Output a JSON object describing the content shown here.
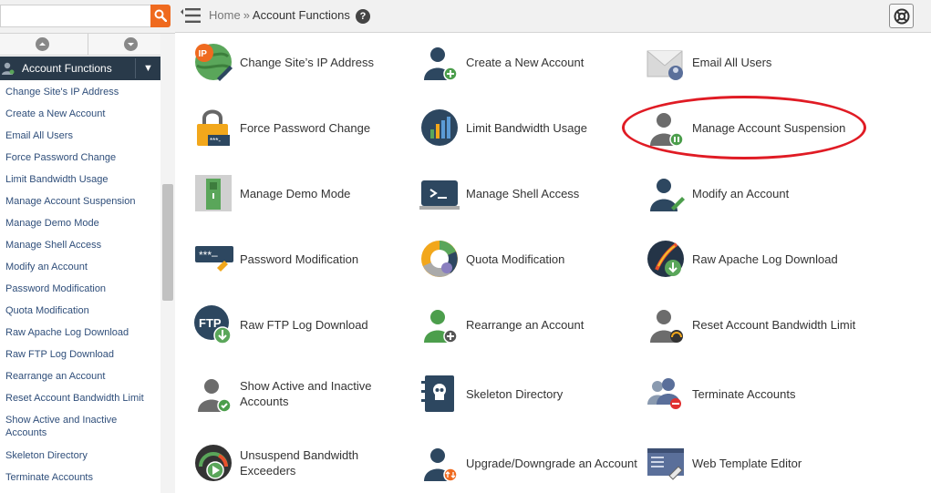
{
  "search": {
    "placeholder": "",
    "value": "",
    "icon": "search-icon"
  },
  "topbar": {
    "breadcrumb_home": "Home",
    "breadcrumb_sep": "»",
    "breadcrumb_current": "Account Functions",
    "help_symbol": "?",
    "support_icon": "lifebuoy-icon"
  },
  "sidebar": {
    "category": "Account Functions",
    "toggle": "▼",
    "items": [
      "Change Site's IP Address",
      "Create a New Account",
      "Email All Users",
      "Force Password Change",
      "Limit Bandwidth Usage",
      "Manage Account Suspension",
      "Manage Demo Mode",
      "Manage Shell Access",
      "Modify an Account",
      "Password Modification",
      "Quota Modification",
      "Raw Apache Log Download",
      "Raw FTP Log Download",
      "Rearrange an Account",
      "Reset Account Bandwidth Limit",
      "Show Active and Inactive Accounts",
      "Skeleton Directory",
      "Terminate Accounts"
    ]
  },
  "grid": [
    [
      {
        "label": "Change Site’s IP Address",
        "icon": "ip-address-icon"
      },
      {
        "label": "Create a New Account",
        "icon": "create-account-icon"
      },
      {
        "label": "Email All Users",
        "icon": "email-users-icon"
      }
    ],
    [
      {
        "label": "Force Password Change",
        "icon": "padlock-icon"
      },
      {
        "label": "Limit Bandwidth Usage",
        "icon": "bandwidth-chart-icon"
      },
      {
        "label": "Manage Account Suspension",
        "icon": "account-suspension-icon"
      }
    ],
    [
      {
        "label": "Manage Demo Mode",
        "icon": "demo-mode-icon"
      },
      {
        "label": "Manage Shell Access",
        "icon": "shell-terminal-icon"
      },
      {
        "label": "Modify an Account",
        "icon": "modify-account-icon"
      }
    ],
    [
      {
        "label": "Password Modification",
        "icon": "password-modify-icon"
      },
      {
        "label": "Quota Modification",
        "icon": "quota-pie-icon"
      },
      {
        "label": "Raw Apache Log Download",
        "icon": "apache-log-icon"
      }
    ],
    [
      {
        "label": "Raw FTP Log Download",
        "icon": "ftp-log-icon"
      },
      {
        "label": "Rearrange an Account",
        "icon": "rearrange-account-icon"
      },
      {
        "label": "Reset Account Bandwidth Limit",
        "icon": "reset-bandwidth-icon"
      }
    ],
    [
      {
        "label": "Show Active and Inactive Accounts",
        "icon": "active-accounts-icon"
      },
      {
        "label": "Skeleton Directory",
        "icon": "skeleton-directory-icon"
      },
      {
        "label": "Terminate Accounts",
        "icon": "terminate-accounts-icon"
      }
    ],
    [
      {
        "label": "Unsuspend Bandwidth Exceeders",
        "icon": "unsuspend-gauge-icon"
      },
      {
        "label": "Upgrade/Downgrade an Account",
        "icon": "upgrade-account-icon"
      },
      {
        "label": "Web Template Editor",
        "icon": "web-template-icon"
      }
    ]
  ],
  "colors": {
    "sidebar_header": "#293a4a",
    "search_button": "#ef6a1f",
    "link": "#2f4e7a",
    "highlight": "#e01b24"
  }
}
